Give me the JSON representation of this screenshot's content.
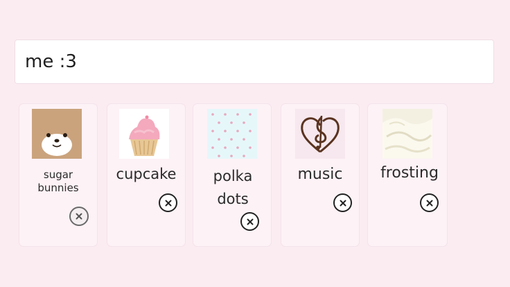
{
  "colors": {
    "background": "#fbecf1",
    "card": "#fdf2f6",
    "field": "#ffffff",
    "text": "#2b2b2b"
  },
  "title_field": {
    "value": "me :3"
  },
  "tags": [
    {
      "label_line1": "sugar",
      "label_line2": "bunnies",
      "image": "teddy-bear-face"
    },
    {
      "label": "cupcake",
      "image": "pink-cupcake"
    },
    {
      "label_line1": "polka",
      "label_line2": "dots",
      "image": "polka-dot-pattern"
    },
    {
      "label": "music",
      "image": "treble-clef-heart"
    },
    {
      "label": "frosting",
      "image": "cream-frosting"
    }
  ],
  "icons": {
    "remove": "close-circle-icon"
  }
}
